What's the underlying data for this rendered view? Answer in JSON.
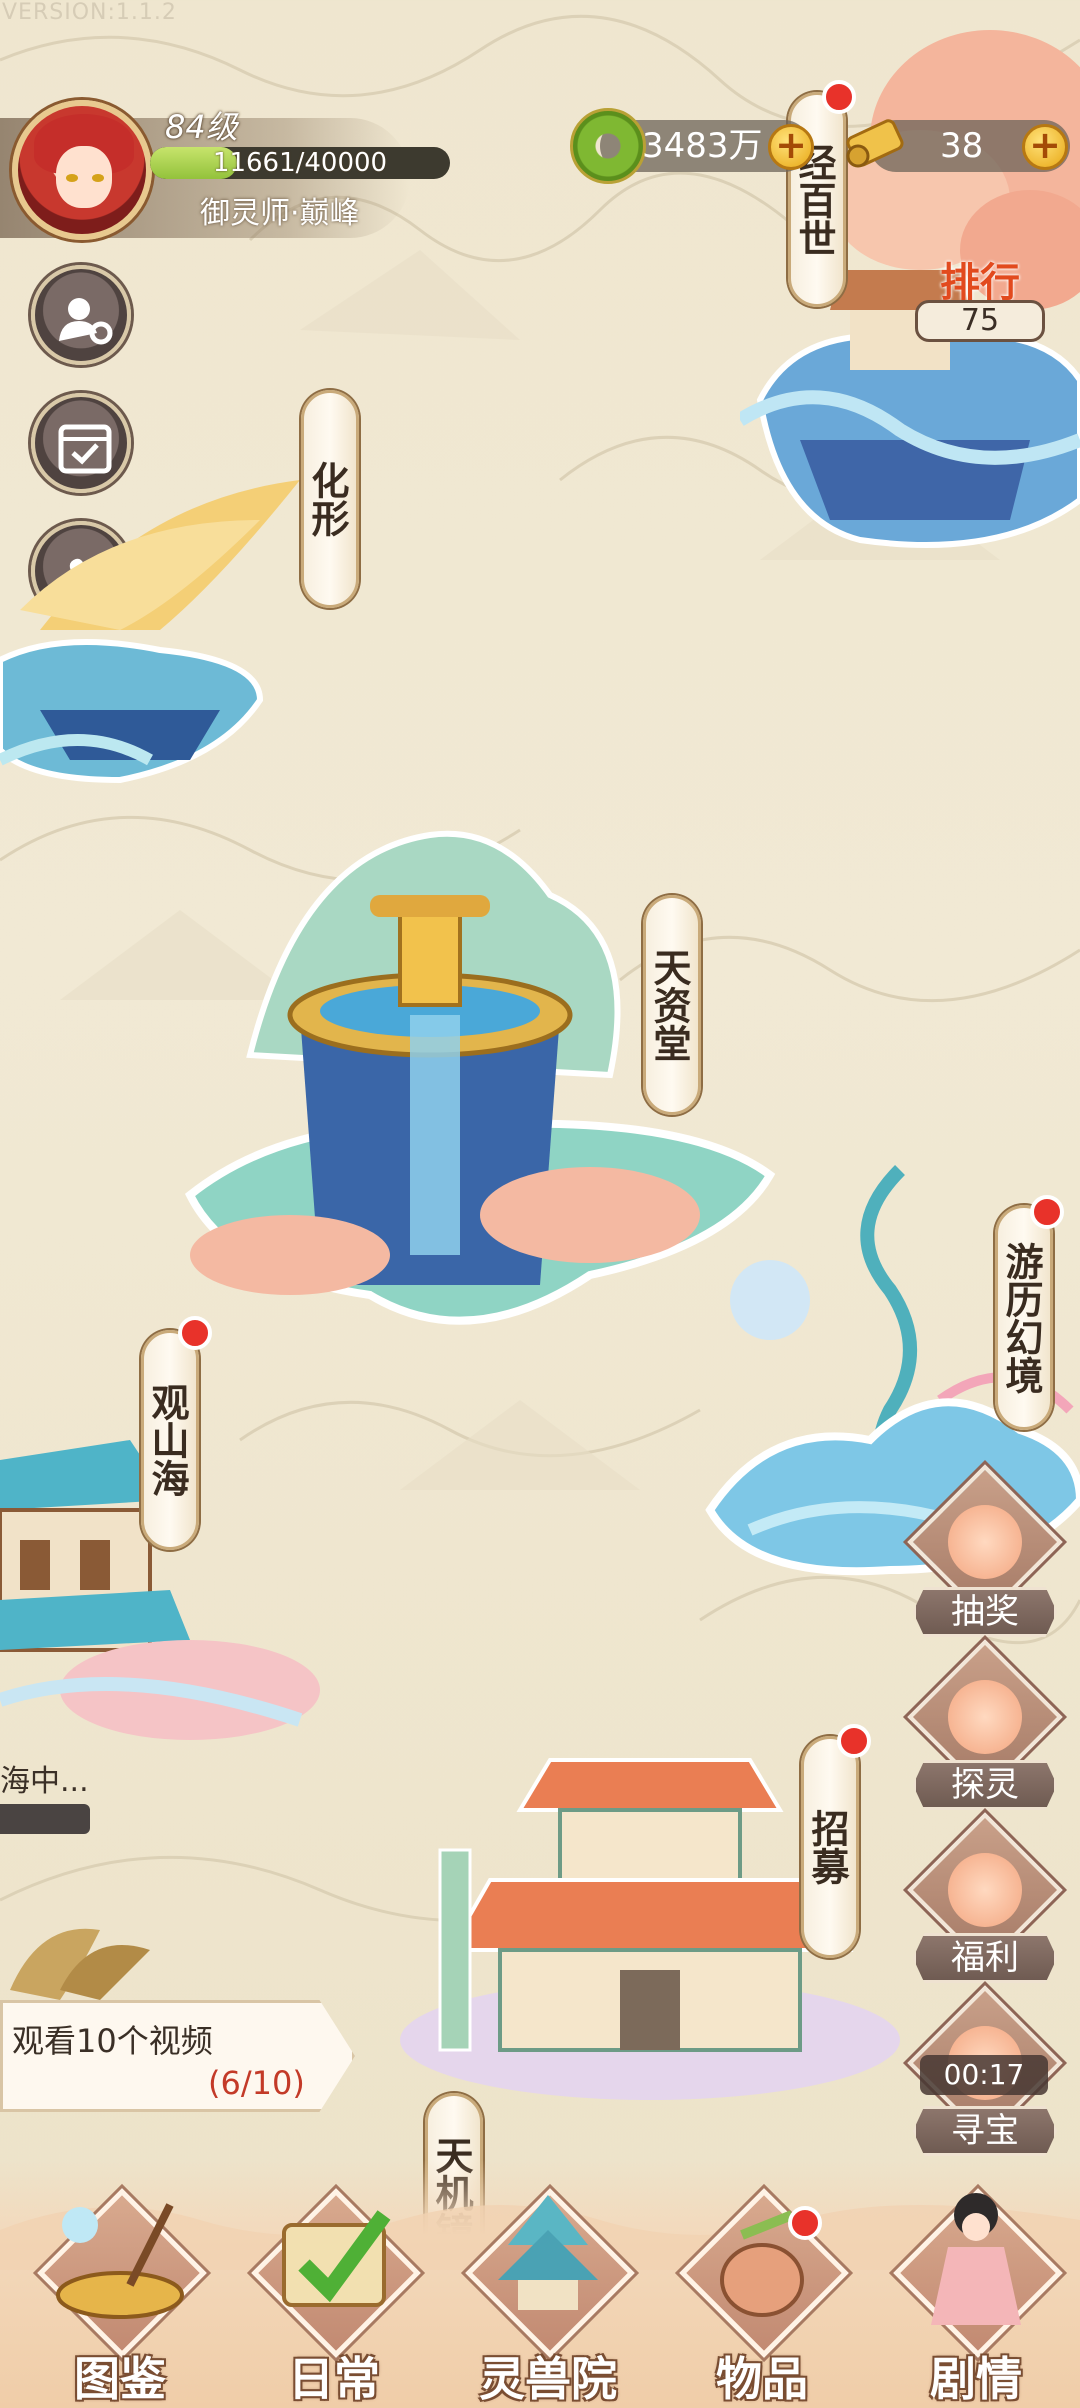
{
  "version": "VERSION:1.1.2",
  "player": {
    "level": "84级",
    "xp_text": "11661/40000",
    "xp_fraction": 0.2915,
    "rank_title": "御灵师·巅峰"
  },
  "currency": {
    "jade_amount": "3483万",
    "scroll_amount": "38"
  },
  "side_buttons": [
    {
      "name": "user-settings-icon"
    },
    {
      "name": "calendar-check-icon"
    },
    {
      "name": "puzzle-icon"
    },
    {
      "name": "gift-icon"
    }
  ],
  "map_labels": {
    "jingbaishi": "经百世",
    "ranking": "排行",
    "ranking_value": "75",
    "huaxing": "化形",
    "tianzitang": "天资堂",
    "youli": "游历幻境",
    "guanshanhai": "观山海",
    "zhaomu": "招募",
    "tianjijing": "天机镜"
  },
  "right_menu": {
    "lottery": "抽奖",
    "explore": "探灵",
    "welfare": "福利",
    "treasure": "寻宝",
    "treasure_timer": "00:17"
  },
  "left_status": "海中...",
  "task": {
    "text": "观看10个视频",
    "progress": "(6/10)"
  },
  "bottom_nav": [
    {
      "label": "图鉴"
    },
    {
      "label": "日常"
    },
    {
      "label": "灵兽院"
    },
    {
      "label": "物品"
    },
    {
      "label": "剧情"
    }
  ],
  "colors": {
    "red_dot": "#e8322a",
    "xp_green": "#93c23b",
    "background": "#efe6cf"
  }
}
